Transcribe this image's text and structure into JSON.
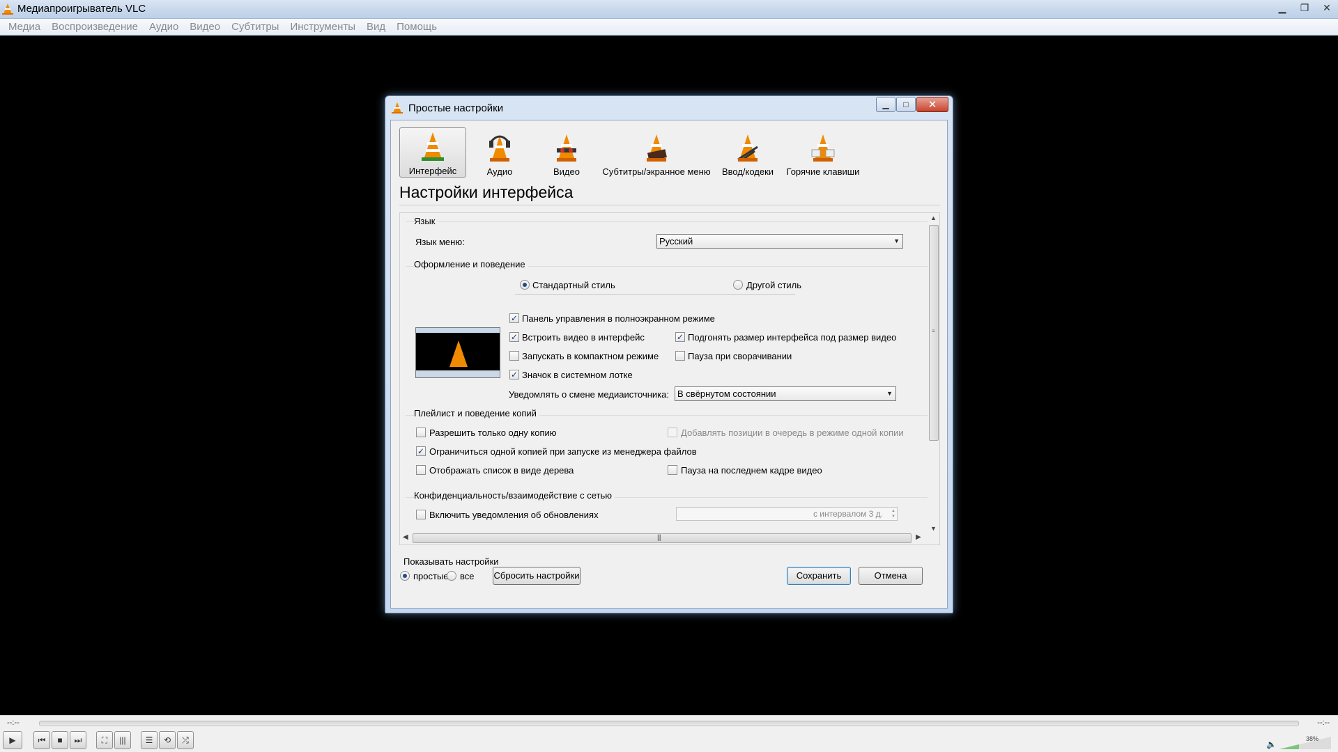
{
  "window": {
    "title": "Медиапроигрыватель VLC",
    "minimize_glyph": "▁",
    "maximize_glyph": "❐",
    "close_glyph": "✕"
  },
  "menubar": {
    "items": [
      "Медиа",
      "Воспроизведение",
      "Аудио",
      "Видео",
      "Субтитры",
      "Инструменты",
      "Вид",
      "Помощь"
    ]
  },
  "dialog": {
    "title": "Простые настройки",
    "categories": [
      {
        "label": "Интерфейс",
        "icon": "interface-cone-icon",
        "selected": true
      },
      {
        "label": "Аудио",
        "icon": "audio-cone-icon",
        "selected": false
      },
      {
        "label": "Видео",
        "icon": "video-cone-icon",
        "selected": false
      },
      {
        "label": "Субтитры/экранное меню",
        "icon": "subtitles-cone-icon",
        "selected": false
      },
      {
        "label": "Ввод/кодеки",
        "icon": "input-codecs-cone-icon",
        "selected": false
      },
      {
        "label": "Горячие клавиши",
        "icon": "hotkeys-cone-icon",
        "selected": false
      }
    ],
    "heading": "Настройки интерфейса",
    "language": {
      "group_title": "Язык",
      "menu_language_label": "Язык меню:",
      "menu_language_value": "Русский"
    },
    "appearance": {
      "group_title": "Оформление и поведение",
      "style_standard": "Стандартный стиль",
      "style_other": "Другой стиль",
      "selected_style": "standard",
      "fullscreen_controller": {
        "label": "Панель управления в полноэкранном режиме",
        "checked": true
      },
      "embed_video": {
        "label": "Встроить видео в интерфейс",
        "checked": true
      },
      "resize_to_video": {
        "label": "Подгонять размер интерфейса под размер видео",
        "checked": true
      },
      "start_minimal": {
        "label": "Запускать в компактном режиме",
        "checked": false
      },
      "pause_minimized": {
        "label": "Пауза при сворачивании",
        "checked": false
      },
      "systray_icon": {
        "label": "Значок в системном лотке",
        "checked": true
      },
      "notify_label": "Уведомлять о смене медиаисточника:",
      "notify_value": "В свёрнутом состоянии"
    },
    "playlist": {
      "group_title": "Плейлист и поведение копий",
      "one_instance": {
        "label": "Разрешить только одну копию",
        "checked": false
      },
      "enqueue_one_instance": {
        "label": "Добавлять позиции в очередь в режиме одной копии",
        "checked": false,
        "disabled": true
      },
      "one_instance_fm": {
        "label": "Ограничиться одной копией при запуске из менеджера файлов",
        "checked": true
      },
      "tree_view": {
        "label": "Отображать список в виде дерева",
        "checked": false
      },
      "pause_last_frame": {
        "label": "Пауза на последнем кадре видео",
        "checked": false
      }
    },
    "privacy": {
      "group_title": "Конфиденциальность/взаимодействие с сетью",
      "update_notify": {
        "label": "Включить уведомления об обновлениях",
        "checked": false
      },
      "interval_value": "с интервалом 3 д."
    },
    "show_settings": {
      "label": "Показывать настройки",
      "simple": "простые",
      "all": "все",
      "selected": "simple"
    },
    "buttons": {
      "reset": "Сбросить настройки",
      "save": "Сохранить",
      "cancel": "Отмена"
    }
  },
  "player": {
    "time_elapsed": "--:--",
    "time_total": "--:--",
    "volume_percent": "38%",
    "volume_level": 0.38
  },
  "colors": {
    "accent": "#1f4c8f",
    "vlc_orange": "#f08a00",
    "titlebar": "#c9d9ec"
  }
}
